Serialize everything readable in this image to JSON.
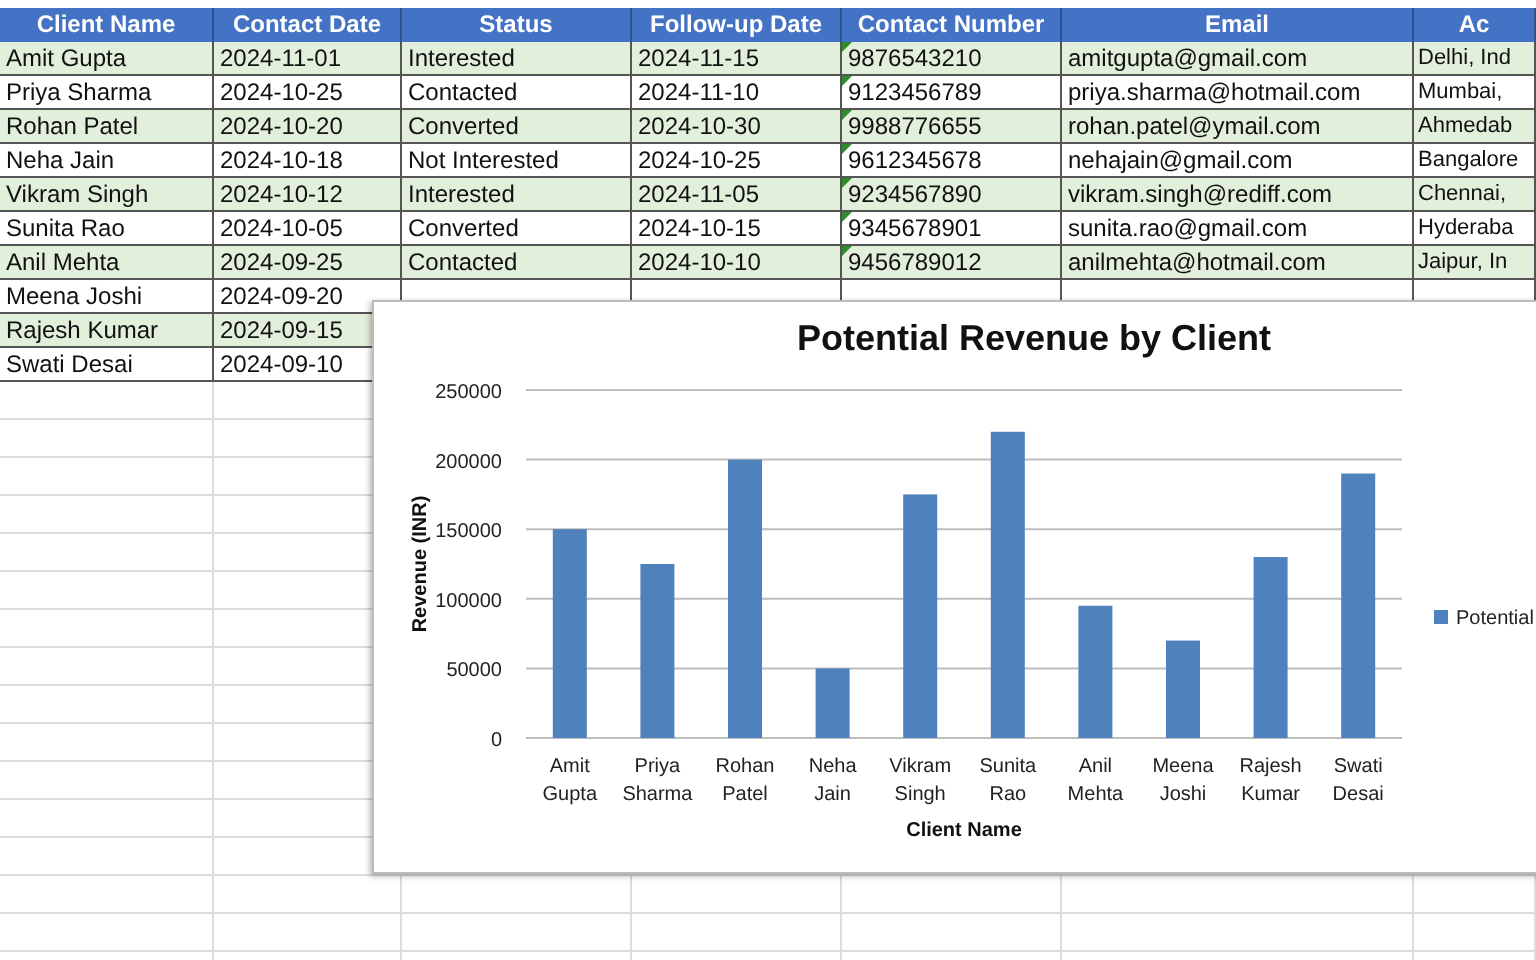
{
  "table": {
    "columns": [
      "Client Name",
      "Contact Date",
      "Status",
      "Follow-up Date",
      "Contact Number",
      "Email",
      "Ac"
    ],
    "rows": [
      {
        "cells": [
          "Amit Gupta",
          "2024-11-01",
          "Interested",
          "2024-11-15",
          "9876543210",
          "amitgupta@gmail.com",
          "Delhi, Ind"
        ],
        "flagged": true
      },
      {
        "cells": [
          "Priya Sharma",
          "2024-10-25",
          "Contacted",
          "2024-11-10",
          "9123456789",
          "priya.sharma@hotmail.com",
          "Mumbai,"
        ],
        "flagged": true
      },
      {
        "cells": [
          "Rohan Patel",
          "2024-10-20",
          "Converted",
          "2024-10-30",
          "9988776655",
          "rohan.patel@ymail.com",
          "Ahmedab"
        ],
        "flagged": true
      },
      {
        "cells": [
          "Neha Jain",
          "2024-10-18",
          "Not Interested",
          "2024-10-25",
          "9612345678",
          "nehajain@gmail.com",
          "Bangalore"
        ],
        "flagged": true
      },
      {
        "cells": [
          "Vikram Singh",
          "2024-10-12",
          "Interested",
          "2024-11-05",
          "9234567890",
          "vikram.singh@rediff.com",
          "Chennai,"
        ],
        "flagged": true
      },
      {
        "cells": [
          "Sunita Rao",
          "2024-10-05",
          "Converted",
          "2024-10-15",
          "9345678901",
          "sunita.rao@gmail.com",
          "Hyderaba"
        ],
        "flagged": true
      },
      {
        "cells": [
          "Anil Mehta",
          "2024-09-25",
          "Contacted",
          "2024-10-10",
          "9456789012",
          "anilmehta@hotmail.com",
          "Jaipur, In"
        ],
        "flagged": true
      },
      {
        "cells": [
          "Meena Joshi",
          "2024-09-20"
        ]
      },
      {
        "cells": [
          "Rajesh Kumar",
          "2024-09-15"
        ]
      },
      {
        "cells": [
          "Swati Desai",
          "2024-09-10"
        ]
      }
    ]
  },
  "chart": {
    "chart_data": {
      "type": "bar",
      "title": "Potential Revenue by Client",
      "xlabel": "Client Name",
      "ylabel": "Revenue (INR)",
      "categories": [
        "Amit Gupta",
        "Priya Sharma",
        "Rohan Patel",
        "Neha Jain",
        "Vikram Singh",
        "Sunita Rao",
        "Anil Mehta",
        "Meena Joshi",
        "Rajesh Kumar",
        "Swati Desai"
      ],
      "series": [
        {
          "name": "Potential",
          "color": "#4f81bd",
          "values": [
            150000,
            125000,
            200000,
            50000,
            175000,
            220000,
            95000,
            70000,
            130000,
            190000
          ]
        }
      ],
      "ylim": [
        0,
        250000
      ],
      "grid": true,
      "yticks": [
        0,
        50000,
        100000,
        150000,
        200000,
        250000
      ]
    }
  }
}
